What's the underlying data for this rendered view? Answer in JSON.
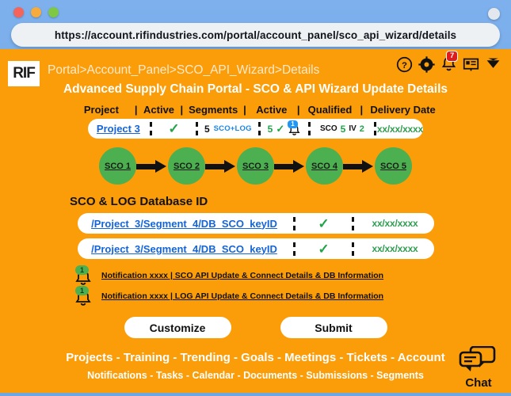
{
  "browser": {
    "url": "https://account.rifindustries.com/portal/account_panel/sco_api_wizard/details",
    "traffic_lights": [
      "close-red",
      "minimize-yellow",
      "maximize-green"
    ],
    "right_control": "menu-circle"
  },
  "header": {
    "logo": "RIF",
    "breadcrumb": "Portal>Account_Panel>SCO_API_Wizard>Details",
    "title": "Advanced Supply Chain Portal - SCO & API Wizard Update Details",
    "icons": [
      {
        "name": "help-icon",
        "glyph": "?"
      },
      {
        "name": "gear-icon",
        "glyph": "gear"
      },
      {
        "name": "bell-icon",
        "glyph": "bell",
        "badge": "7"
      },
      {
        "name": "presentation-icon",
        "glyph": "screen"
      },
      {
        "name": "chevron-down-icon",
        "glyph": "chevron"
      }
    ]
  },
  "project_table": {
    "columns": [
      "Project",
      "Active",
      "Segments",
      "Active",
      "Qualified",
      "Delivery Date"
    ],
    "separator": "|",
    "row": {
      "project": "Project 3",
      "active_check": "✓",
      "segments_count": "5",
      "segments_label": "SCO+LOG",
      "active_count": "5",
      "active_check2": "✓",
      "active_alert_badge": "1",
      "qualified_sco_label": "SCO",
      "qualified_sco": "5",
      "qualified_iv_label": "IV",
      "qualified_iv": "2",
      "delivery_date": "xx/xx/xxxx"
    }
  },
  "flow": {
    "nodes": [
      "SCO 1",
      "SCO 2",
      "SCO 3",
      "SCO 4",
      "SCO 5"
    ]
  },
  "database": {
    "section_title": "SCO & LOG Database ID",
    "rows": [
      {
        "id": "/Project_3/Segment_4/DB_SCO_keyID",
        "check": "✓",
        "date": "xx/xx/xxxx"
      },
      {
        "id": "/Project_3/Segment_4/DB_SCO_keyID",
        "check": "✓",
        "date": "xx/xx/xxxx"
      }
    ]
  },
  "notifications": [
    {
      "badge": "1",
      "text": "Notification xxxx | SCO API Update & Connect Details & DB Information"
    },
    {
      "badge": "1",
      "text": "Notification xxxx | LOG API Update & Connect Details & DB Information"
    }
  ],
  "actions": {
    "customize": "Customize",
    "submit": "Submit"
  },
  "footer": {
    "primary": "Projects - Training - Trending - Goals - Meetings - Tickets - Account",
    "secondary": "Notifications - Tasks - Calendar - Documents - Submissions - Segments",
    "chat_label": "Chat"
  },
  "colors": {
    "page_bg": "#fb9d09",
    "browser_bg": "#7db0ec",
    "node_green": "#4caf50",
    "link_blue": "#1565d8",
    "check_green": "#22a34a",
    "badge_red": "#e01b1b"
  }
}
